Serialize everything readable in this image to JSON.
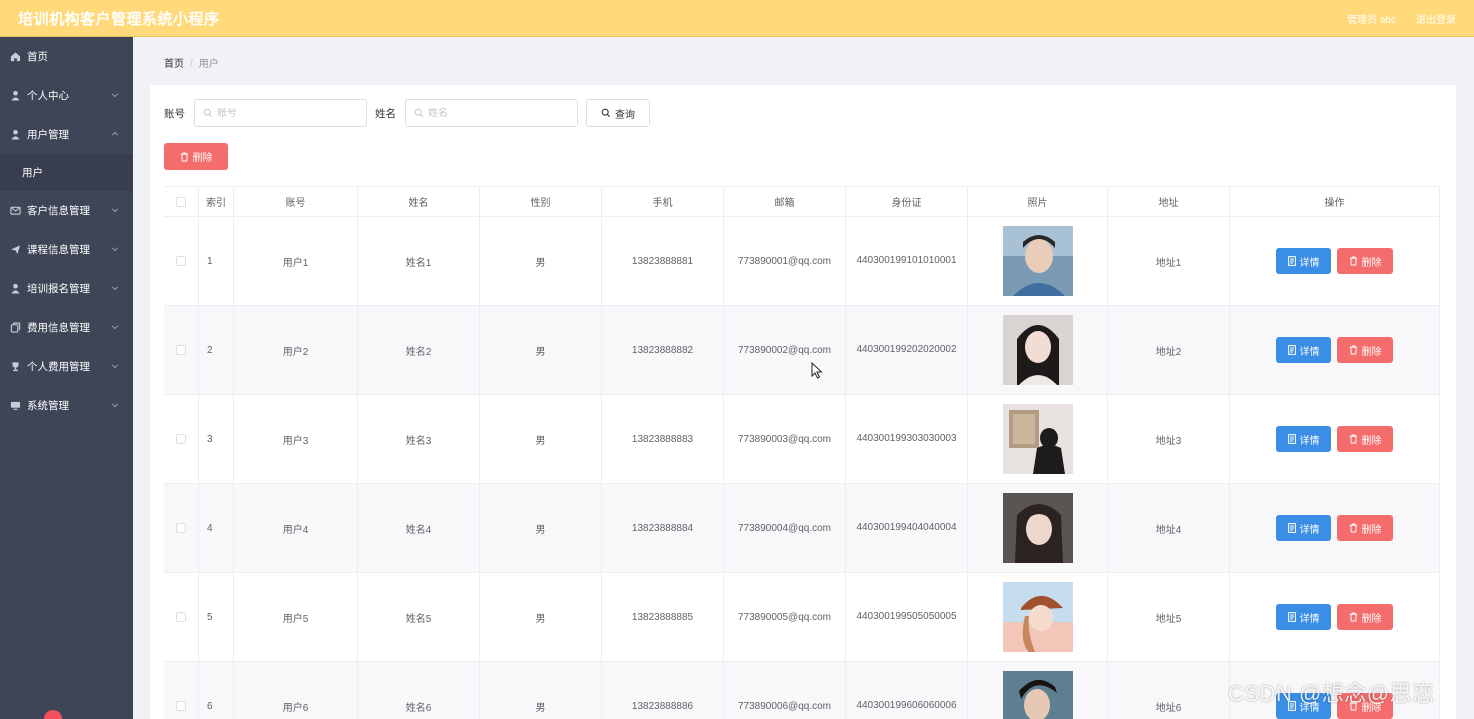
{
  "header": {
    "title": "培训机构客户管理系统小程序",
    "admin_label": "管理员 abc",
    "logout_label": "退出登录"
  },
  "sidebar": {
    "items": [
      {
        "label": "首页",
        "icon": "home-icon"
      },
      {
        "label": "个人中心",
        "icon": "user-icon"
      },
      {
        "label": "用户管理",
        "icon": "user-icon",
        "expanded": true,
        "sub": "用户"
      },
      {
        "label": "客户信息管理",
        "icon": "mail-icon"
      },
      {
        "label": "课程信息管理",
        "icon": "send-icon"
      },
      {
        "label": "培训报名管理",
        "icon": "user-icon"
      },
      {
        "label": "费用信息管理",
        "icon": "copy-icon"
      },
      {
        "label": "个人费用管理",
        "icon": "trophy-icon"
      },
      {
        "label": "系统管理",
        "icon": "monitor-icon"
      }
    ]
  },
  "breadcrumb": {
    "home": "首页",
    "current": "用户"
  },
  "search": {
    "account_label": "账号",
    "account_placeholder": "账号",
    "name_label": "姓名",
    "name_placeholder": "姓名",
    "query_label": "查询"
  },
  "toolbar": {
    "delete_label": "删除"
  },
  "table": {
    "headers": [
      "索引",
      "账号",
      "姓名",
      "性别",
      "手机",
      "邮箱",
      "身份证",
      "照片",
      "地址",
      "操作"
    ],
    "detail_label": "详情",
    "delete_label": "删除",
    "rows": [
      {
        "index": "1",
        "account": "用户1",
        "name": "姓名1",
        "gender": "男",
        "phone": "13823888881",
        "email": "773890001@qq.com",
        "idcard": "440300199101010001",
        "address": "地址1"
      },
      {
        "index": "2",
        "account": "用户2",
        "name": "姓名2",
        "gender": "男",
        "phone": "13823888882",
        "email": "773890002@qq.com",
        "idcard": "440300199202020002",
        "address": "地址2"
      },
      {
        "index": "3",
        "account": "用户3",
        "name": "姓名3",
        "gender": "男",
        "phone": "13823888883",
        "email": "773890003@qq.com",
        "idcard": "440300199303030003",
        "address": "地址3"
      },
      {
        "index": "4",
        "account": "用户4",
        "name": "姓名4",
        "gender": "男",
        "phone": "13823888884",
        "email": "773890004@qq.com",
        "idcard": "440300199404040004",
        "address": "地址4"
      },
      {
        "index": "5",
        "account": "用户5",
        "name": "姓名5",
        "gender": "男",
        "phone": "13823888885",
        "email": "773890005@qq.com",
        "idcard": "440300199505050005",
        "address": "地址5"
      },
      {
        "index": "6",
        "account": "用户6",
        "name": "姓名6",
        "gender": "男",
        "phone": "13823888886",
        "email": "773890006@qq.com",
        "idcard": "440300199606060006",
        "address": "地址6"
      }
    ]
  },
  "watermark": "CSDN @想念@思恋",
  "colors": {
    "header": "#ffd97a",
    "sidebar": "#3e4557",
    "primary": "#3a8ee6",
    "danger": "#f56c6c"
  }
}
